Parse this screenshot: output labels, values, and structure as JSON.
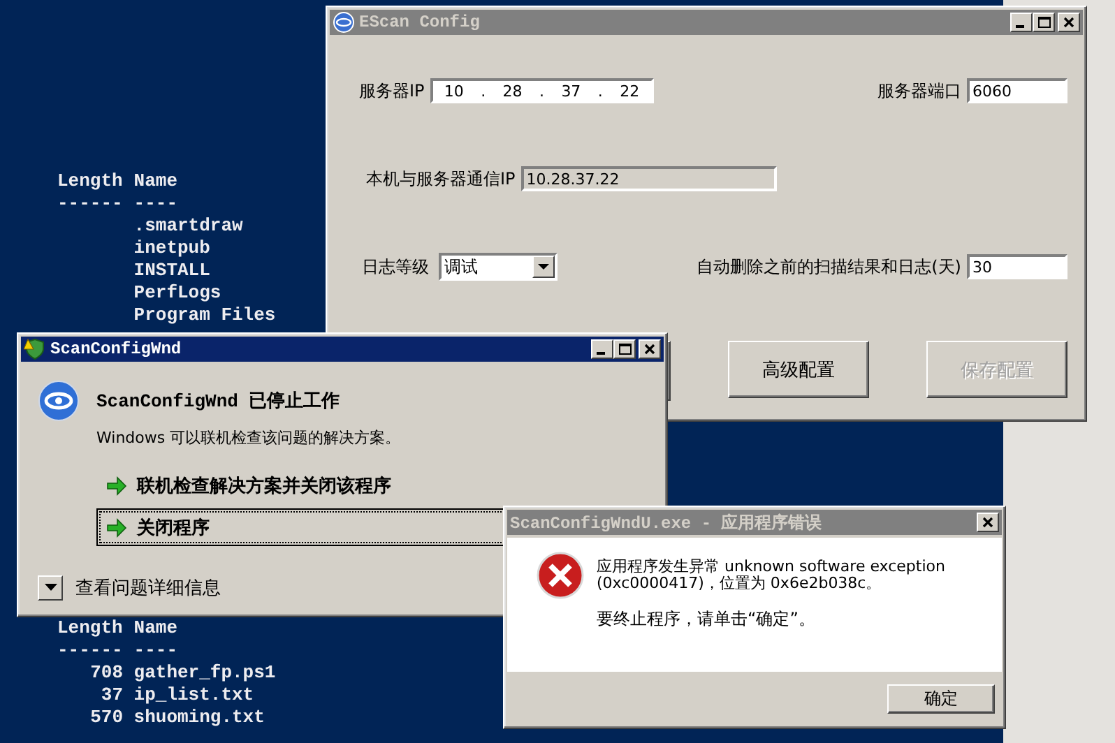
{
  "console": {
    "blocks": [
      {
        "header": [
          "Length",
          "Name"
        ],
        "rule": [
          "------",
          "----"
        ],
        "rows": [
          {
            "name": ".smartdraw"
          },
          {
            "name": "inetpub"
          },
          {
            "name": "INSTALL"
          },
          {
            "name": "PerfLogs"
          },
          {
            "name": "Program Files"
          }
        ]
      },
      {
        "header": [
          "Length",
          "Name"
        ],
        "rule": [
          "------",
          "----"
        ],
        "rows": [
          {
            "length": "708",
            "name": "gather_fp.ps1"
          },
          {
            "length": "37",
            "name": "ip_list.txt"
          },
          {
            "length": "570",
            "name": "shuoming.txt"
          }
        ]
      }
    ]
  },
  "config_window": {
    "title": "EScan Config",
    "active": false,
    "server_ip": {
      "label": "服务器IP",
      "octets": [
        "10",
        "28",
        "37",
        "22"
      ],
      "separator": "."
    },
    "server_port": {
      "label": "服务器端口",
      "value": "6060"
    },
    "local_ip": {
      "label": "本机与服务器通信IP",
      "value": "10.28.37.22"
    },
    "log_level": {
      "label": "日志等级",
      "value": "调试"
    },
    "auto_delete_days": {
      "label": "自动删除之前的扫描结果和日志(天)",
      "value": "30"
    },
    "buttons": [
      {
        "label": "高级配置",
        "disabled": false
      },
      {
        "label": "保存配置",
        "disabled": true
      }
    ]
  },
  "stopped_window": {
    "title": "ScanConfigWnd",
    "active": true,
    "heading": "ScanConfigWnd 已停止工作",
    "description": "Windows 可以联机检查该问题的解决方案。",
    "options": [
      {
        "label": "联机检查解决方案并关闭该程序",
        "selected": false
      },
      {
        "label": "关闭程序",
        "selected": true
      }
    ],
    "details_toggle": {
      "label": "查看问题详细信息",
      "expanded": false
    }
  },
  "error_dialog": {
    "title": "ScanConfigWndU.exe - 应用程序错误",
    "active": false,
    "message_lines": [
      "应用程序发生异常 unknown software exception",
      "(0xc0000417)，位置为 0x6e2b038c。"
    ],
    "instruction": "要终止程序，请单击“确定”。",
    "ok_button": "确定"
  }
}
